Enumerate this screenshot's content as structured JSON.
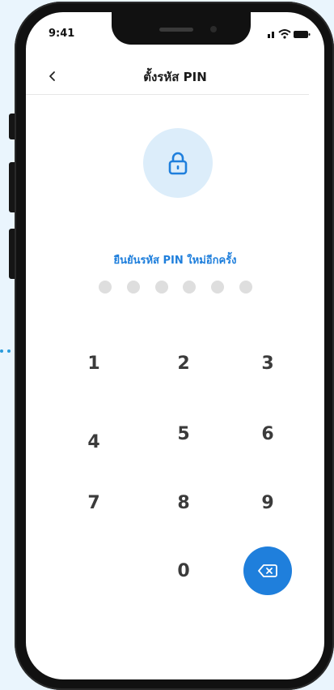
{
  "status_bar": {
    "time": "9:41"
  },
  "header": {
    "title": "ตั้งรหัส PIN",
    "back_icon": "chevron-left-icon"
  },
  "lock": {
    "icon": "lock-icon"
  },
  "pin_entry": {
    "prompt": "ยืนยันรหัส PIN ใหม่อีกครั้ง",
    "length": 6,
    "filled": 0
  },
  "keypad": {
    "keys": [
      "1",
      "2",
      "3",
      "4",
      "5",
      "6",
      "7",
      "8",
      "9",
      "0"
    ],
    "backspace_icon": "backspace-icon"
  },
  "colors": {
    "accent": "#1f7fdc",
    "lock_bg": "#dcedfa",
    "dot_empty": "#dedede",
    "background": "#eaf5fd"
  }
}
